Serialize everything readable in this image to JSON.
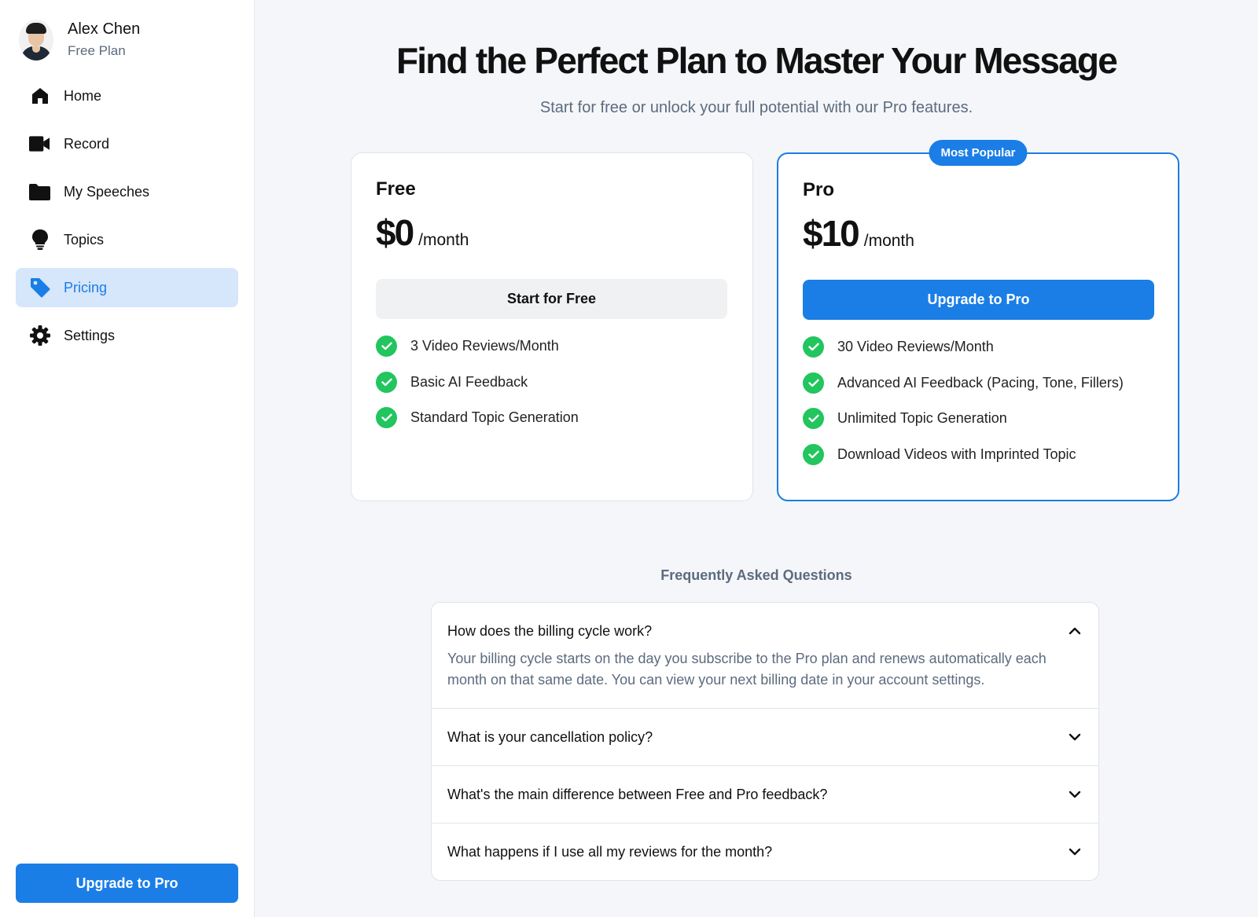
{
  "profile": {
    "name": "Alex Chen",
    "plan": "Free Plan"
  },
  "nav": [
    {
      "label": "Home",
      "icon": "home-icon",
      "active": false
    },
    {
      "label": "Record",
      "icon": "video-camera-icon",
      "active": false
    },
    {
      "label": "My Speeches",
      "icon": "folder-icon",
      "active": false
    },
    {
      "label": "Topics",
      "icon": "lightbulb-icon",
      "active": false
    },
    {
      "label": "Pricing",
      "icon": "tag-icon",
      "active": true
    },
    {
      "label": "Settings",
      "icon": "gear-icon",
      "active": false
    }
  ],
  "sidebar": {
    "upgrade_label": "Upgrade to Pro"
  },
  "header": {
    "title": "Find the Perfect Plan to Master Your Message",
    "subtitle": "Start for free or unlock your full potential with our Pro features."
  },
  "plans": {
    "free": {
      "name": "Free",
      "price": "$0",
      "period": "/month",
      "button": "Start for Free",
      "features": [
        "3 Video Reviews/Month",
        "Basic AI Feedback",
        "Standard Topic Generation"
      ]
    },
    "pro": {
      "badge": "Most Popular",
      "name": "Pro",
      "price": "$10",
      "period": "/month",
      "button": "Upgrade to Pro",
      "features": [
        "30 Video Reviews/Month",
        "Advanced AI Feedback (Pacing, Tone, Fillers)",
        "Unlimited Topic Generation",
        "Download Videos with Imprinted Topic"
      ]
    }
  },
  "faq": {
    "title": "Frequently Asked Questions",
    "items": [
      {
        "question": "How does the billing cycle work?",
        "answer": "Your billing cycle starts on the day you subscribe to the Pro plan and renews automatically each month on that same date. You can view your next billing date in your account settings.",
        "open": true
      },
      {
        "question": "What is your cancellation policy?",
        "open": false
      },
      {
        "question": "What's the main difference between Free and Pro feedback?",
        "open": false
      },
      {
        "question": "What happens if I use all my reviews for the month?",
        "open": false
      }
    ]
  },
  "colors": {
    "accent": "#1a7ee6",
    "active_bg": "#d6e6fb",
    "check": "#22c55e",
    "muted": "#5c6b7e"
  }
}
